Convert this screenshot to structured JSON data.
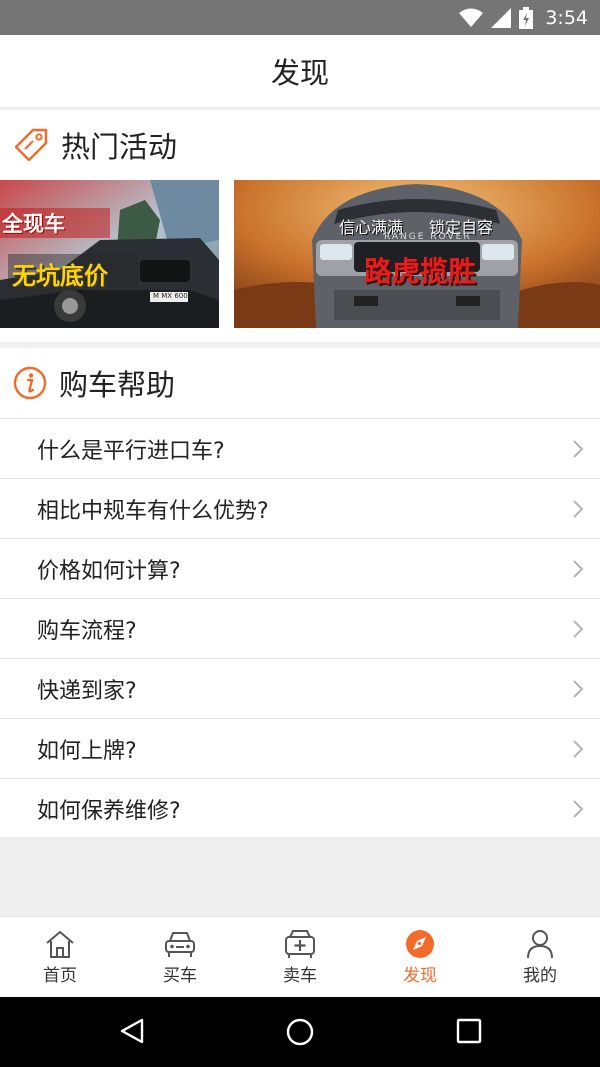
{
  "status": {
    "time": "3:54"
  },
  "header": {
    "title": "发现"
  },
  "hot": {
    "title": "热门活动",
    "banner1": {
      "line1": "全现车",
      "line2": "无坑底价",
      "plate": "M MX 6001"
    },
    "banner2": {
      "slogan_a": "信心满满",
      "slogan_b": "锁定自容",
      "headline": "路虎揽胜",
      "badge": "RANGE ROVER"
    }
  },
  "help": {
    "title": "购车帮助",
    "items": [
      {
        "label": "什么是平行进口车?"
      },
      {
        "label": "相比中规车有什么优势?"
      },
      {
        "label": "价格如何计算?"
      },
      {
        "label": "购车流程?"
      },
      {
        "label": "快递到家?"
      },
      {
        "label": "如何上牌?"
      },
      {
        "label": "如何保养维修?"
      }
    ]
  },
  "tabs": [
    {
      "label": "首页",
      "icon": "home-icon"
    },
    {
      "label": "买车",
      "icon": "car-icon"
    },
    {
      "label": "卖车",
      "icon": "sell-car-icon"
    },
    {
      "label": "发现",
      "icon": "compass-icon"
    },
    {
      "label": "我的",
      "icon": "person-icon"
    }
  ],
  "colors": {
    "accent": "#f36b2a",
    "status_bar": "#757575",
    "background": "#efefef"
  }
}
